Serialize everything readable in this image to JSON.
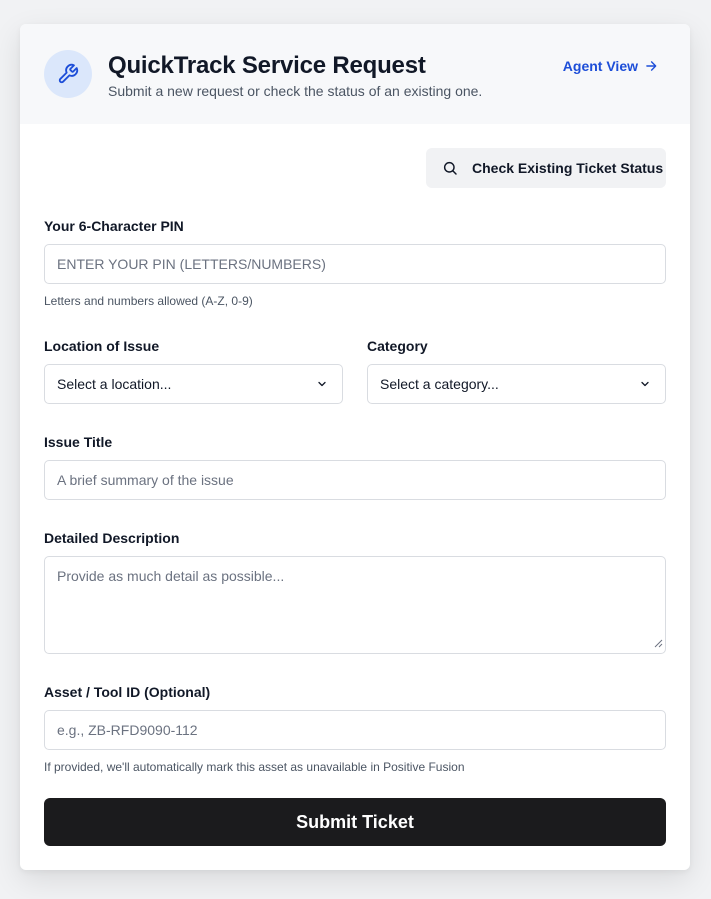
{
  "header": {
    "title": "QuickTrack Service Request",
    "subtitle": "Submit a new request or check the status of an existing one.",
    "agent_link": "Agent View",
    "logo_icon": "wrench-icon"
  },
  "colors": {
    "accent": "#1d4ed8",
    "logo_bg": "#dbe7fb",
    "submit_bg": "#1b1b1d"
  },
  "check_status_button": {
    "label": "Check Existing Ticket Status",
    "icon": "search-icon"
  },
  "form": {
    "pin": {
      "label": "Your 6-Character PIN",
      "placeholder": "ENTER YOUR PIN (LETTERS/NUMBERS)",
      "help": "Letters and numbers allowed (A-Z, 0-9)"
    },
    "location": {
      "label": "Location of Issue",
      "selected": "Select a location..."
    },
    "category": {
      "label": "Category",
      "selected": "Select a category..."
    },
    "issue_title": {
      "label": "Issue Title",
      "placeholder": "A brief summary of the issue"
    },
    "description": {
      "label": "Detailed Description",
      "placeholder": "Provide as much detail as possible..."
    },
    "asset": {
      "label": "Asset / Tool ID (Optional)",
      "placeholder": "e.g., ZB-RFD9090-112",
      "help": "If provided, we'll automatically mark this asset as unavailable in Positive Fusion"
    },
    "submit_label": "Submit Ticket"
  }
}
